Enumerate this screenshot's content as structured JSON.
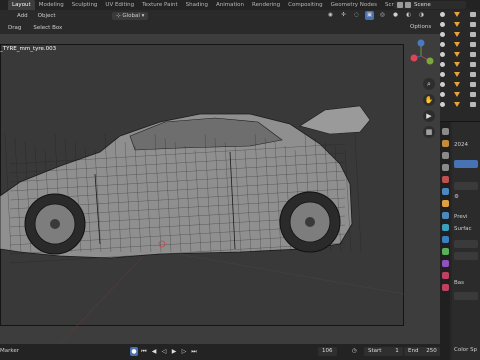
{
  "workspace_tabs": [
    "Layout",
    "Modeling",
    "Sculpting",
    "UV Editing",
    "Texture Paint",
    "Shading",
    "Animation",
    "Rendering",
    "Compositing",
    "Geometry Nodes",
    "Scripting"
  ],
  "scene": {
    "label": "Scene"
  },
  "viewport_header": {
    "items": [
      "Add",
      "Object"
    ],
    "orientation": "Global"
  },
  "tool_header": {
    "items": [
      "Drag",
      "Select Box"
    ],
    "options": "Options"
  },
  "viewport": {
    "object_label": "_TYRE_mm_tyre.003",
    "gizmo_axes": [
      "Y",
      "Z",
      "X"
    ],
    "wire_color": "#1b1b1b",
    "body_color": "#8f8f8f"
  },
  "timeline": {
    "marker": "Marker",
    "current_frame": "106",
    "start_label": "Start",
    "start_value": "1",
    "end_label": "End",
    "end_value": "250"
  },
  "properties": {
    "year_fragment": "2024",
    "preview": "Previ",
    "surface": "Surfac",
    "base": "Bas",
    "color_sp": "Color Sp"
  }
}
